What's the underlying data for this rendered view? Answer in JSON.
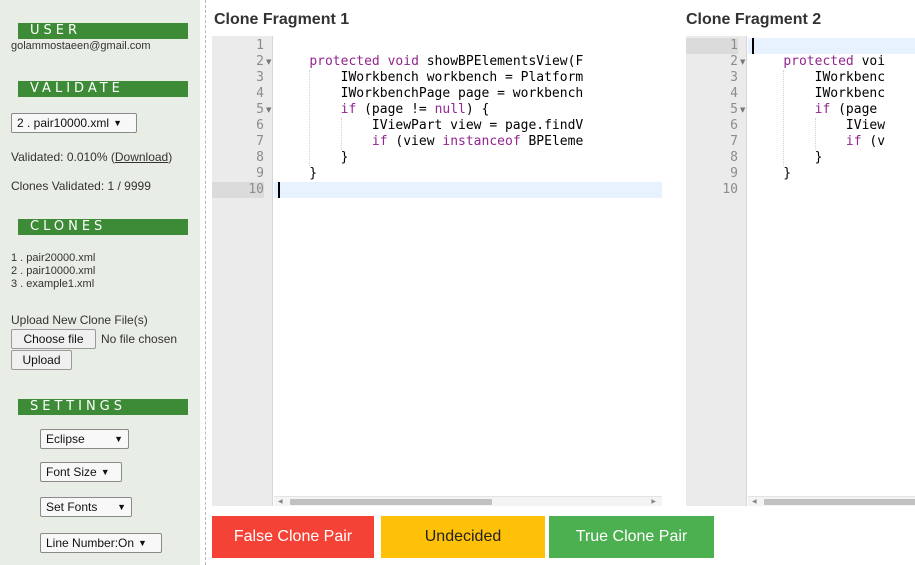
{
  "sidebar": {
    "user": {
      "header": "USER",
      "email": "golammostaeen@gmail.com"
    },
    "validate": {
      "header": "VALIDATE",
      "selected_file": "2 . pair10000.xml",
      "validated_prefix": "Validated: 0.010% (",
      "download_link": "Download",
      "validated_suffix": ")",
      "clones_validated": "Clones Validated: 1 / 9999"
    },
    "clones": {
      "header": "CLONES",
      "items": [
        "1 . pair20000.xml",
        "2 . pair10000.xml",
        "3 . example1.xml"
      ],
      "upload_label": "Upload New Clone File(s)",
      "choose_file_label": "Choose file",
      "no_file_text": "No file chosen",
      "upload_button": "Upload"
    },
    "settings": {
      "header": "SETTINGS",
      "theme": "Eclipse",
      "font_size": "Font Size",
      "set_fonts": "Set Fonts",
      "line_number": "Line Number:On"
    }
  },
  "editors": [
    {
      "title": "Clone Fragment 1",
      "line_numbers": [
        "1",
        "2",
        "3",
        "4",
        "5",
        "6",
        "7",
        "8",
        "9",
        "10"
      ],
      "code": [
        "",
        "    protected void showBPElementsView(F",
        "        IWorkbench workbench = Platform",
        "        IWorkbenchPage page = workbench",
        "        if (page != null) {",
        "            IViewPart view = page.findV",
        "            if (view instanceof BPEleme",
        "        }",
        "    }",
        ""
      ],
      "active_line": "10"
    },
    {
      "title": "Clone Fragment 2",
      "line_numbers": [
        "1",
        "2",
        "3",
        "4",
        "5",
        "6",
        "7",
        "8",
        "9",
        "10"
      ],
      "code": [
        "",
        "    protected voi",
        "        IWorkbenc",
        "        IWorkbenc",
        "        if (page ",
        "            IView",
        "            if (v",
        "        }",
        "    }",
        ""
      ],
      "active_line": "1"
    }
  ],
  "actions": {
    "false_label": "False Clone Pair",
    "undecided_label": "Undecided",
    "true_label": "True Clone Pair"
  },
  "colors": {
    "section_header": "#3d8b37",
    "sidebar_bg": "#e8eee6",
    "false_button": "#f44336",
    "undecided_button": "#ffc107",
    "true_button": "#4caf50",
    "keyword": "#93268f",
    "active_line_bg": "#e8f2fe"
  },
  "icons": {
    "dropdown": "triangle-down-icon",
    "fold": "fold-arrow-icon",
    "scroll_left": "scroll-left-icon",
    "scroll_right": "scroll-right-icon"
  }
}
